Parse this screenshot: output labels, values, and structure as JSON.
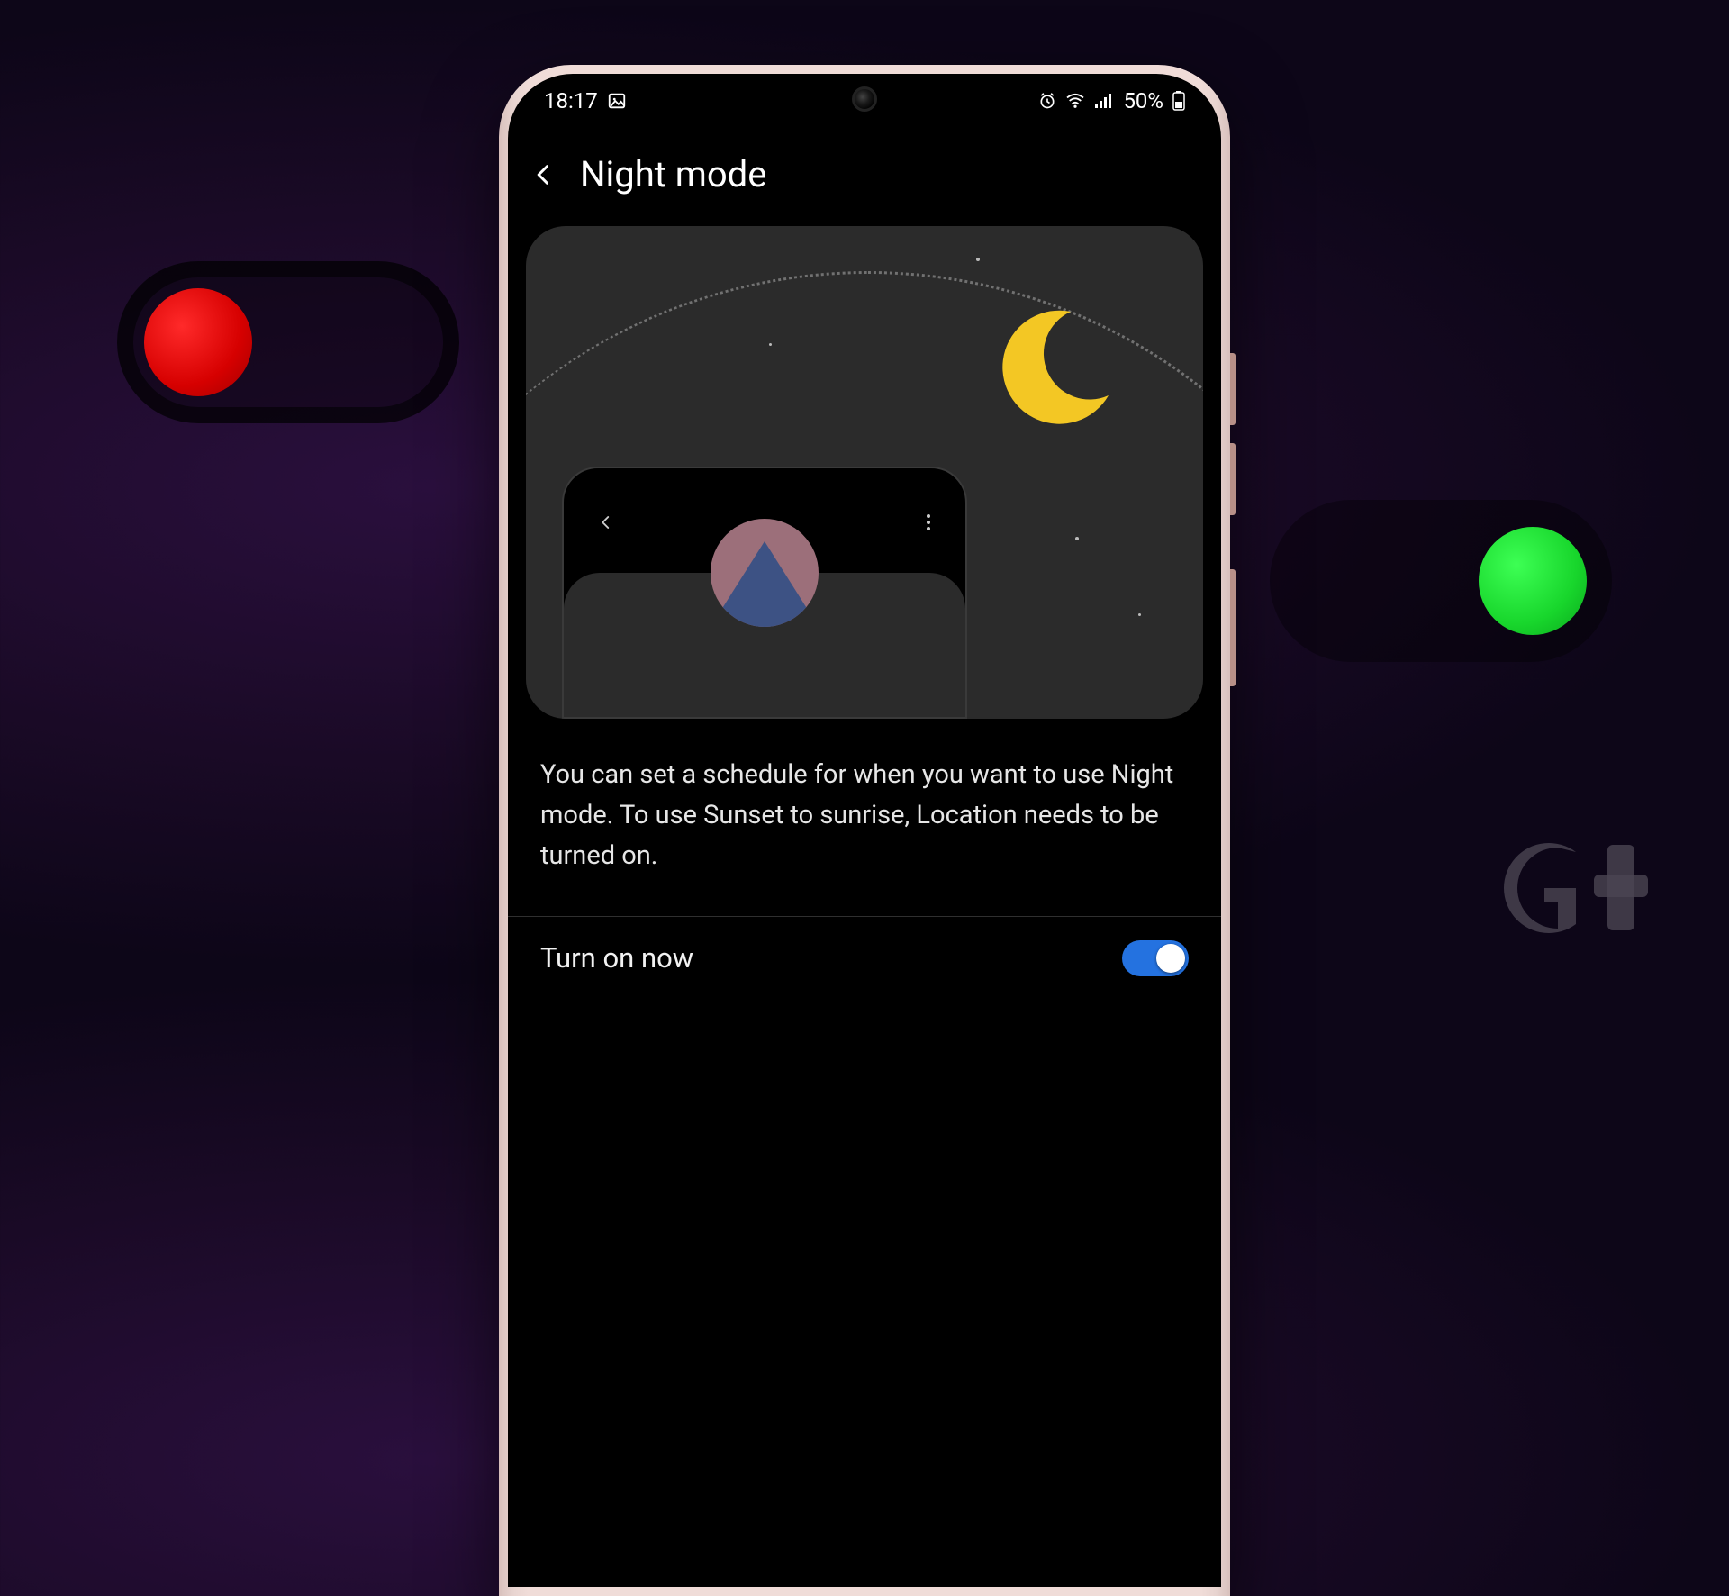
{
  "statusbar": {
    "time": "18:17",
    "battery": "50%"
  },
  "header": {
    "title": "Night mode"
  },
  "description": "You can set a schedule for when you want to use Night mode. To use Sunset to sunrise, Location needs to be turned on.",
  "row": {
    "turn_on_label": "Turn on now",
    "turn_on_state": true
  },
  "watermark": "Gt",
  "bg_toggles": {
    "off_state": false,
    "on_state": true
  }
}
